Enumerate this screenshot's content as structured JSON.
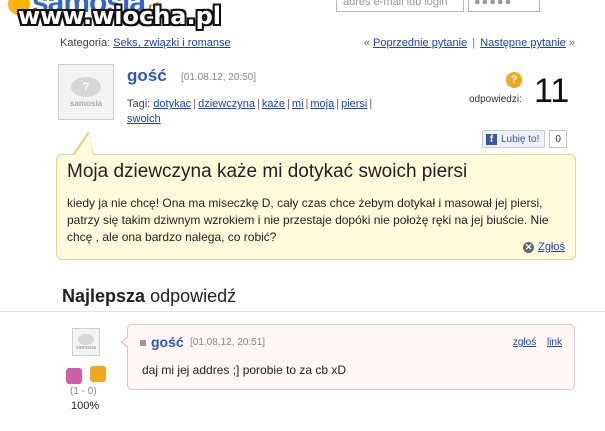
{
  "header": {
    "logo_text": "samosia",
    "logo_suffix": ".pl",
    "email_placeholder": "adres e-mail lub login",
    "password_mask": "●●●●●",
    "watermark": "www.wiocha.pl"
  },
  "breadcrumb": {
    "label": "Kategoria:",
    "category": "Seks, związki i romanse"
  },
  "question_nav": {
    "prev_arrow": "«",
    "prev": "Poprzednie pytanie",
    "separator": "|",
    "next": "Następne pytanie",
    "next_arrow": "»"
  },
  "question": {
    "author": "gość",
    "date": "[01.08.12, 20:50]",
    "tags_label": "Tagi:",
    "tags": [
      "dotykac",
      "dziewczyna",
      "każe",
      "mi",
      "moja",
      "piersi",
      "swoich"
    ],
    "answers_icon": "?",
    "answers_label": "odpowiedzi:",
    "answers_count": "11",
    "like_label": "Lubię to!",
    "like_count": "0",
    "title": "Moja dziewczyna każe mi dotykać swoich piersi",
    "body": "kiedy ja nie chcę! Ona ma miseczkę D, cały czas chce żebym dotykał i masował jej piersi, patrzy się takim dziwnym wzrokiem i nie przestaje dopóki nie położę ręki na jej biuście. Nie chcę , ale ona bardzo nalega, co robić?",
    "report_label": "Zgłoś"
  },
  "best_answer": {
    "heading_bold": "Najlepsza",
    "heading_rest": "odpowiedź",
    "author": "gość",
    "date": "[01.08.12, 20:51]",
    "report_link": "zgłoś",
    "link_link": "link",
    "text": "daj mi jej addres ;] porobie to za cb xD",
    "votes": "(1 - 0)",
    "percent": "100%"
  },
  "colors": {
    "link": "#1a44b8",
    "author": "#2b56c4",
    "question_bg": "#fffbdc",
    "answer_bg": "#fff6f6",
    "accent_orange": "#f0a91e"
  }
}
